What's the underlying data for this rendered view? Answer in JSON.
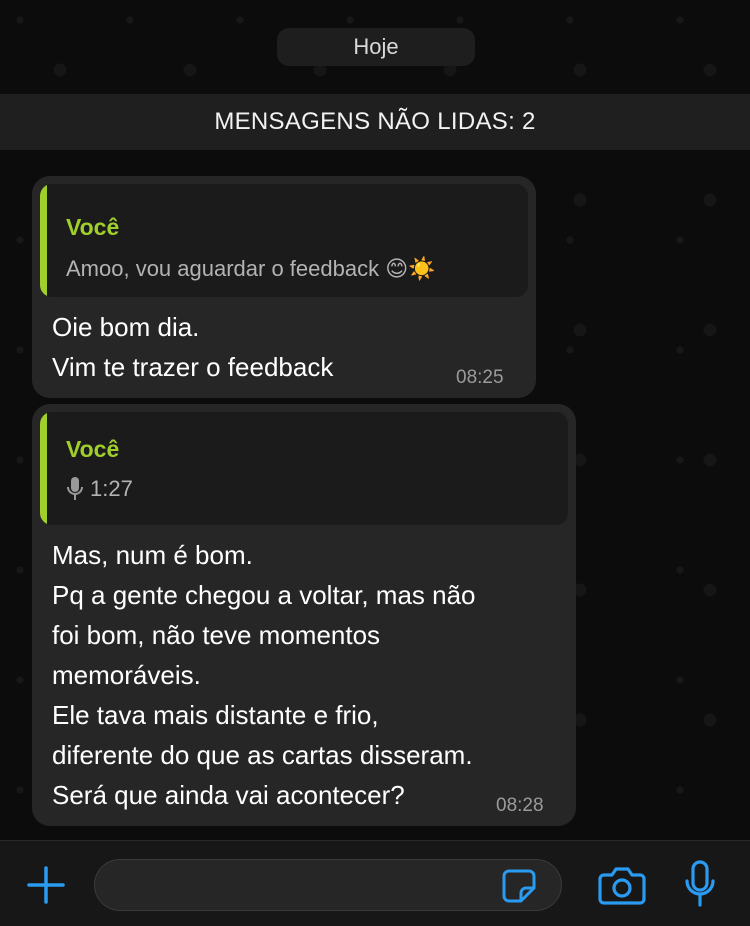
{
  "chat": {
    "date_separator": "Hoje",
    "unread_banner": "MENSAGENS NÃO LIDAS: 2"
  },
  "messages": [
    {
      "reply_author": "Você",
      "reply_text": "Amoo, vou aguardar o feedback 😊☀️",
      "lines": [
        "Oie bom dia.",
        "Vim te trazer o feedback"
      ],
      "time": "08:25"
    },
    {
      "reply_author": "Você",
      "reply_audio_duration": "1:27",
      "reply_icon": "microphone-icon",
      "lines": [
        "Mas, num é bom.",
        "Pq a gente chegou a voltar, mas não",
        "foi bom, não teve momentos",
        "memoráveis.",
        "Ele tava mais distante e frio,",
        "diferente do que as cartas disseram.",
        "Será que ainda vai acontecer?"
      ],
      "time": "08:28"
    }
  ],
  "composer": {
    "input_value": "",
    "icons": [
      "plus-icon",
      "sticker-icon",
      "camera-icon",
      "microphone-icon"
    ]
  },
  "colors": {
    "accent": "#a0cf2c",
    "toolbar_icon": "#2a9bf0",
    "bubble": "#262627",
    "background": "#0b0b0b"
  }
}
